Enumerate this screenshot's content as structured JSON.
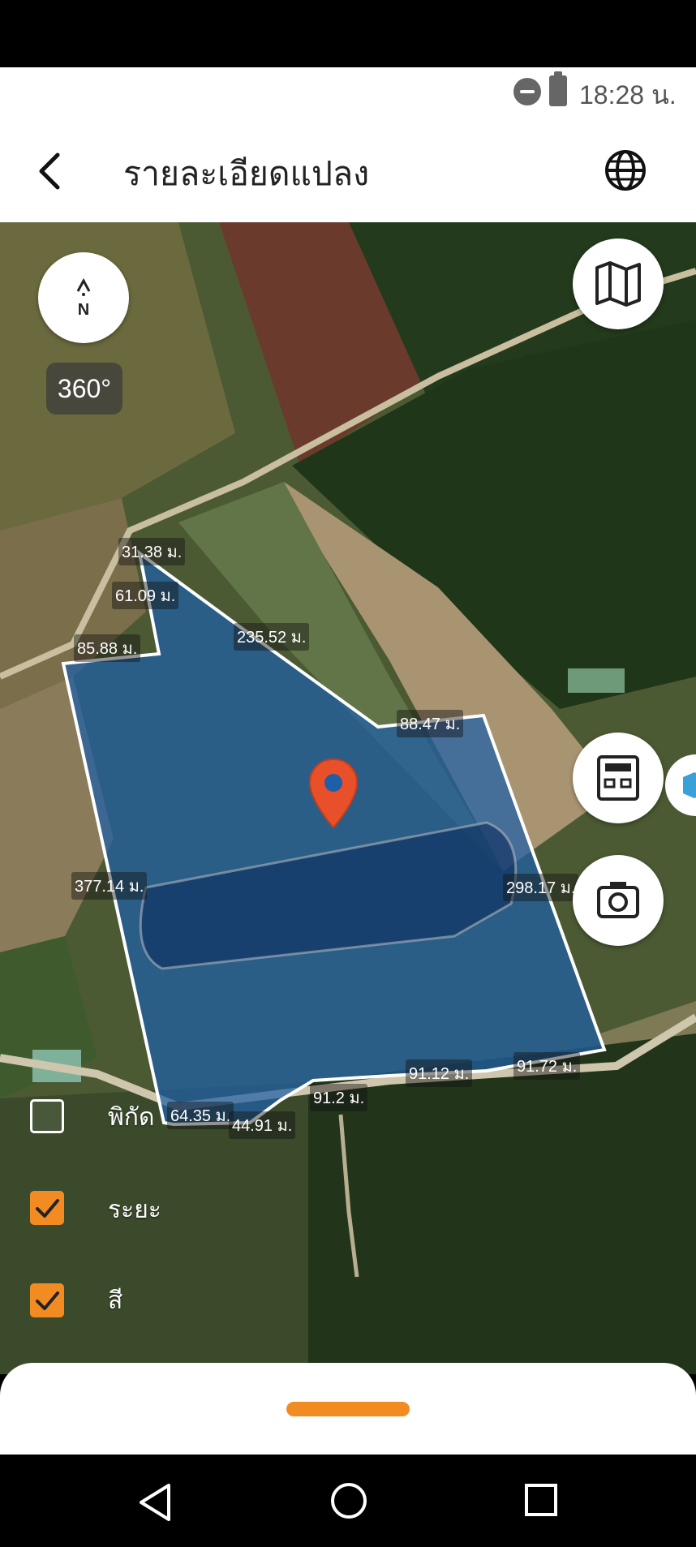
{
  "status_bar": {
    "time": "18:28 น."
  },
  "header": {
    "title": "รายละเอียดแปลง"
  },
  "map": {
    "compass": {
      "label": "N",
      "angle_badge": "360°"
    },
    "distance_labels": [
      "31.38 ม.",
      "61.09 ม.",
      "85.88 ม.",
      "235.52 ม.",
      "88.47 ม.",
      "377.14 ม.",
      "298.17 ม.",
      "91.12 ม.",
      "91.72 ม.",
      "91.2 ม.",
      "64.35 ม.",
      "44.91 ม."
    ],
    "layer_toggles": [
      {
        "label": "พิกัด",
        "checked": false
      },
      {
        "label": "ระยะ",
        "checked": true
      },
      {
        "label": "สี",
        "checked": true
      }
    ]
  },
  "colors": {
    "accent": "#f28c22",
    "pin": "#e8502a",
    "plot_fill": "#1f5fa8"
  },
  "icons": {
    "back": "chevron-left-icon",
    "language": "globe-icon",
    "map_type": "map-icon",
    "calculator": "calculator-icon",
    "camera": "camera-icon",
    "cube": "cube-icon"
  }
}
